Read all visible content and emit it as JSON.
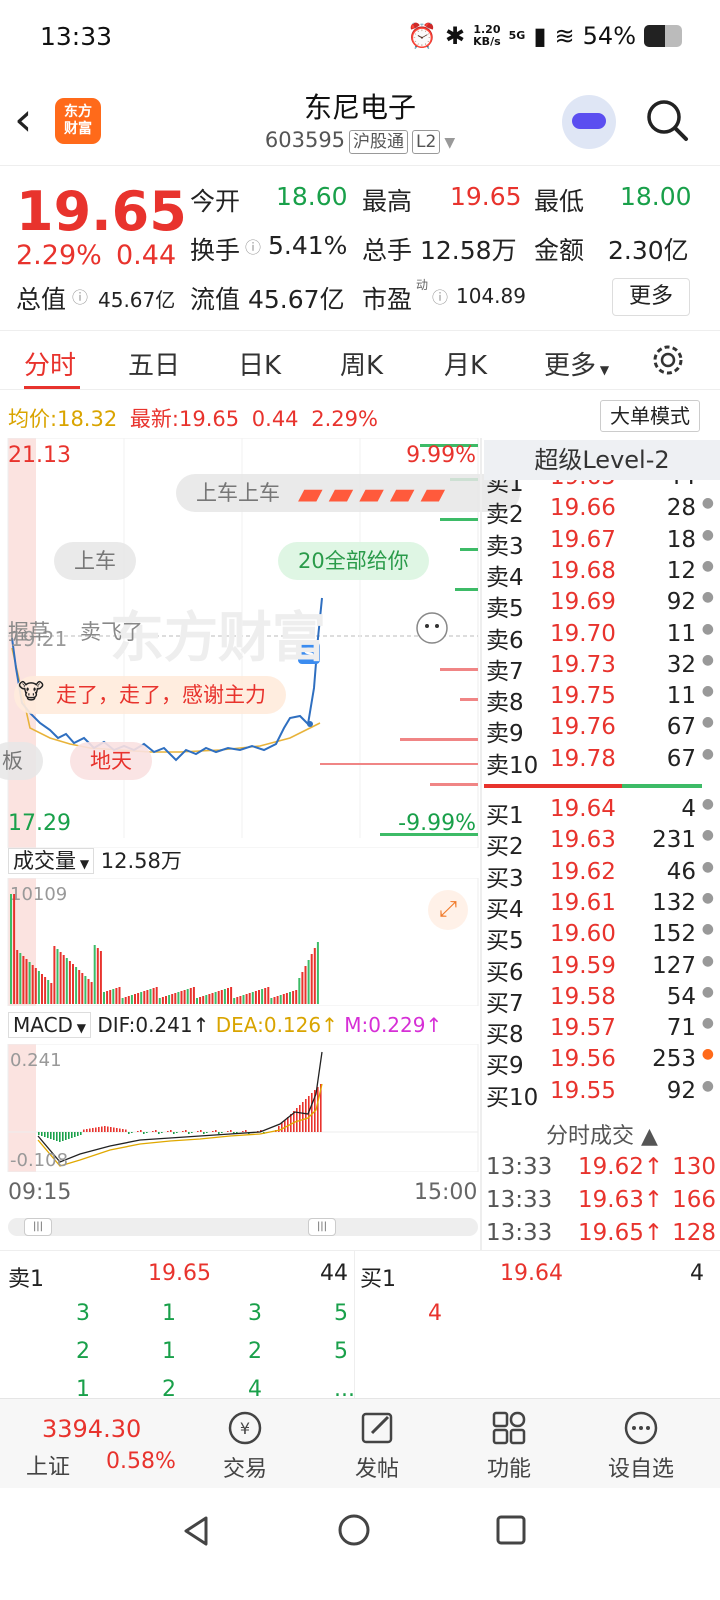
{
  "status": {
    "time": "13:33",
    "speed_top": "1.20",
    "speed_bottom": "KB/s",
    "network": "5G",
    "battery": "54%"
  },
  "header": {
    "logo_line1": "东方",
    "logo_line2": "财富",
    "title": "东尼电子",
    "code": "603595",
    "tag1": "沪股通",
    "tag2": "L2"
  },
  "quote": {
    "price": "19.65",
    "change_pct": "2.29%",
    "change": "0.44",
    "open_label": "今开",
    "open": "18.60",
    "high_label": "最高",
    "high": "19.65",
    "low_label": "最低",
    "low": "18.00",
    "turnover_label": "换手",
    "turnover": "5.41%",
    "volume_label": "总手",
    "volume": "12.58万",
    "amount_label": "金额",
    "amount": "2.30亿",
    "mcap_label": "总值",
    "mcap": "45.67亿",
    "float_label": "流值",
    "float": "45.67亿",
    "pe_label": "市盈",
    "pe_sup": "动",
    "pe": "104.89",
    "more": "更多"
  },
  "tabs": [
    "分时",
    "五日",
    "日K",
    "周K",
    "月K",
    "更多"
  ],
  "intraday": {
    "avg_label": "均价:",
    "avg": "18.32",
    "latest_label": "最新:",
    "latest": "19.65",
    "chg": "0.44",
    "pct": "2.29%",
    "big_order_mode": "大单模式",
    "y_top": "21.13",
    "y_bottom": "17.29",
    "pct_top": "9.99%",
    "pct_bottom": "-9.99%",
    "ref_price": "19.21",
    "danmaku": [
      "上车上车",
      "上车",
      "20全部给你",
      "握草",
      "卖飞了",
      "走了，走了，感谢主力",
      "板",
      "地天"
    ],
    "watermark": "东方财富",
    "s_marker": "S"
  },
  "volume": {
    "label": "成交量",
    "value": "12.58万",
    "max": "10109"
  },
  "macd": {
    "label": "MACD",
    "dif": "DIF:0.241",
    "dea": "DEA:0.126",
    "m": "M:0.229",
    "top": "0.241",
    "bottom": "-0.108"
  },
  "time_axis": {
    "start": "09:15",
    "end": "15:00"
  },
  "level2": {
    "title": "超级Level-2",
    "asks": [
      {
        "l": "卖10",
        "p": "19.78",
        "v": "67"
      },
      {
        "l": "卖9",
        "p": "19.76",
        "v": "67"
      },
      {
        "l": "卖8",
        "p": "19.75",
        "v": "11"
      },
      {
        "l": "卖7",
        "p": "19.73",
        "v": "32"
      },
      {
        "l": "卖6",
        "p": "19.70",
        "v": "11"
      },
      {
        "l": "卖5",
        "p": "19.69",
        "v": "92"
      },
      {
        "l": "卖4",
        "p": "19.68",
        "v": "12"
      },
      {
        "l": "卖3",
        "p": "19.67",
        "v": "18"
      },
      {
        "l": "卖2",
        "p": "19.66",
        "v": "28"
      },
      {
        "l": "卖1",
        "p": "19.65",
        "v": "44"
      }
    ],
    "bids": [
      {
        "l": "买1",
        "p": "19.64",
        "v": "4"
      },
      {
        "l": "买2",
        "p": "19.63",
        "v": "231"
      },
      {
        "l": "买3",
        "p": "19.62",
        "v": "46"
      },
      {
        "l": "买4",
        "p": "19.61",
        "v": "132"
      },
      {
        "l": "买5",
        "p": "19.60",
        "v": "152"
      },
      {
        "l": "买6",
        "p": "19.59",
        "v": "127"
      },
      {
        "l": "买7",
        "p": "19.58",
        "v": "54"
      },
      {
        "l": "买8",
        "p": "19.57",
        "v": "71"
      },
      {
        "l": "买9",
        "p": "19.56",
        "v": "253"
      },
      {
        "l": "买10",
        "p": "19.55",
        "v": "92"
      }
    ],
    "ticks_title": "分时成交",
    "ticks": [
      {
        "t": "13:33",
        "p": "19.62↑",
        "v": "130"
      },
      {
        "t": "13:33",
        "p": "19.63↑",
        "v": "166"
      },
      {
        "t": "13:33",
        "p": "19.65↑",
        "v": "128"
      }
    ]
  },
  "depth": {
    "ask_label": "卖1",
    "ask_price": "19.65",
    "ask_vol": "44",
    "bid_label": "买1",
    "bid_price": "19.64",
    "bid_vol": "4",
    "ask_rows": [
      [
        "3",
        "1",
        "3",
        "5"
      ],
      [
        "2",
        "1",
        "2",
        "5"
      ],
      [
        "1",
        "2",
        "4",
        "..."
      ]
    ],
    "bid_rows": [
      [
        "4"
      ]
    ]
  },
  "bottom": {
    "index_value": "3394.30",
    "index_name": "上证",
    "index_pct": "0.58%",
    "items": [
      "交易",
      "发帖",
      "功能",
      "设自选"
    ]
  }
}
